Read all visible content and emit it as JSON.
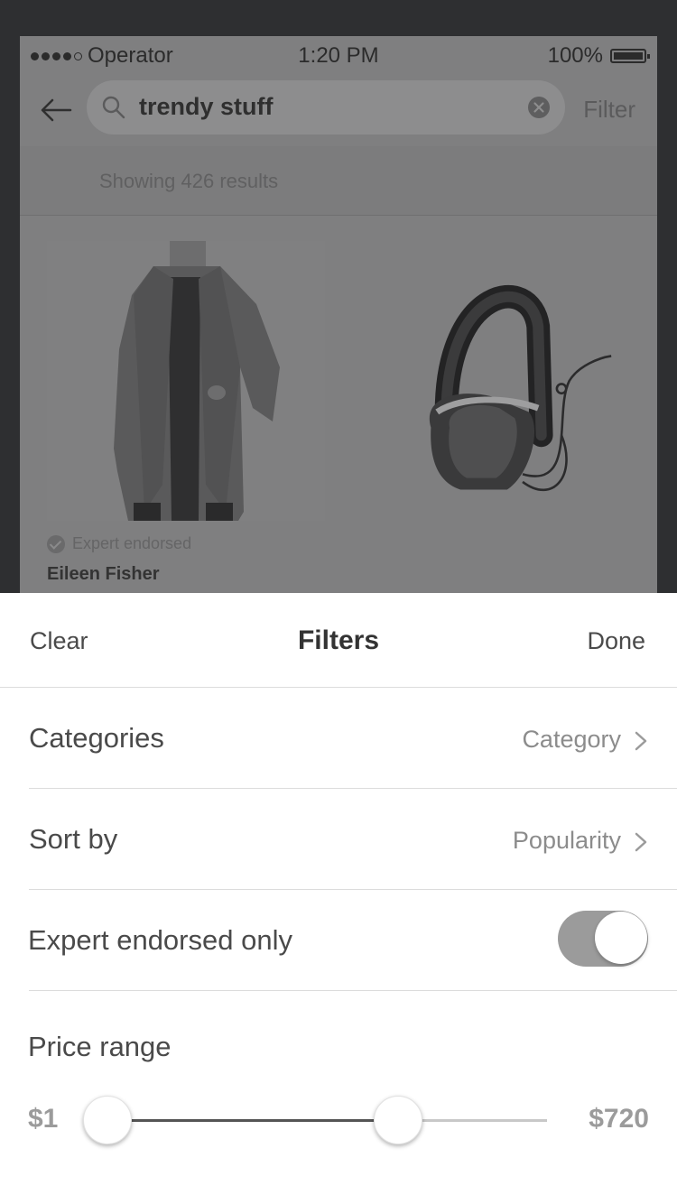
{
  "status_bar": {
    "carrier": "Operator",
    "time": "1:20 PM",
    "battery": "100%"
  },
  "search": {
    "query": "trendy stuff",
    "filter_label": "Filter"
  },
  "results": {
    "summary": "Showing 426 results"
  },
  "products": [
    {
      "image_icon": "cardigan-image",
      "endorsed_label": "Expert endorsed",
      "brand": "Eileen Fisher"
    },
    {
      "image_icon": "headphones-image"
    }
  ],
  "filters": {
    "clear_label": "Clear",
    "title": "Filters",
    "done_label": "Done",
    "categories": {
      "label": "Categories",
      "value": "Category"
    },
    "sort": {
      "label": "Sort by",
      "value": "Popularity"
    },
    "expert": {
      "label": "Expert endorsed only",
      "enabled": true
    },
    "price": {
      "label": "Price range",
      "min": "$1",
      "max": "$720",
      "selected_max_fraction": 0.66
    }
  },
  "colors": {
    "overlay": "#7f7f80",
    "sheet_bg": "#ffffff",
    "toggle_on": "#9b9b9b",
    "slider_active": "#555555"
  }
}
